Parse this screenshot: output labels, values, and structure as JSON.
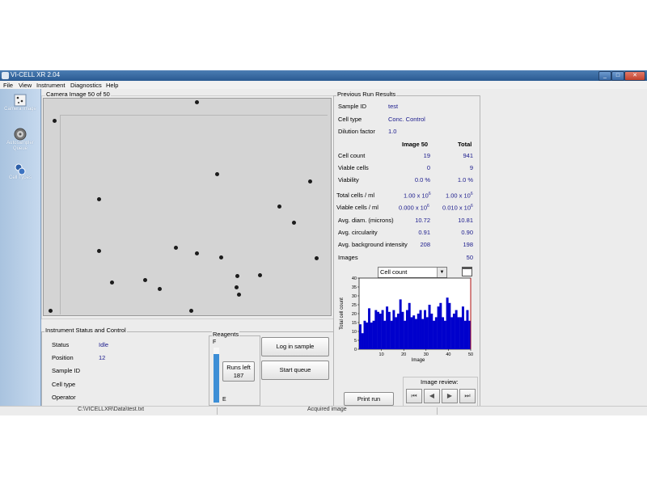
{
  "window": {
    "title": "VI-CELL XR 2.04",
    "controls": [
      "_",
      "□",
      "✕"
    ]
  },
  "menu": [
    "File",
    "View",
    "Instrument",
    "Diagnostics",
    "Help"
  ],
  "sidebar": {
    "items": [
      {
        "label": "Camera Image",
        "icon": "camera-icon"
      },
      {
        "label": "Autosampler Queue",
        "icon": "carousel-icon"
      },
      {
        "label": "Cell Types",
        "icon": "cell-types-icon"
      }
    ]
  },
  "camera": {
    "title": "Camera Image 50 of 50"
  },
  "instrument": {
    "title": "Instrument Status and Control",
    "rows": [
      {
        "label": "Status",
        "value": "Idle"
      },
      {
        "label": "Position",
        "value": "12"
      },
      {
        "label": "Sample ID",
        "value": ""
      },
      {
        "label": "Cell type",
        "value": ""
      },
      {
        "label": "Operator",
        "value": ""
      }
    ],
    "reagents_title": "Reagents",
    "reagent_full": "F",
    "reagent_empty": "E",
    "reagent_level": 0.88,
    "runs_left_label": "Runs left",
    "runs_left": "187",
    "log_button": "Log in sample",
    "start_button": "Start queue"
  },
  "results": {
    "title": "Previous Run Results",
    "sample_id_label": "Sample ID",
    "sample_id": "test",
    "cell_type_label": "Cell type",
    "cell_type": "Conc. Control",
    "dilution_label": "Dilution factor",
    "dilution": "1.0",
    "col_image": "Image 50",
    "col_total": "Total",
    "rows": [
      {
        "label": "Cell count",
        "image": "19",
        "total": "941"
      },
      {
        "label": "Viable cells",
        "image": "0",
        "total": "9"
      },
      {
        "label": "Viability",
        "image": "0.0 %",
        "total": "1.0 %"
      },
      {
        "label": "Total cells / ml",
        "image": "1.00  x 10",
        "image_exp": "6",
        "total": "1.00  x 10",
        "total_exp": "6"
      },
      {
        "label": "Viable cells / ml",
        "image": "0.000  x 10",
        "image_exp": "6",
        "total": "0.010  x 10",
        "total_exp": "6"
      },
      {
        "label": "Avg. diam. (microns)",
        "image": "10.72",
        "total": "10.81"
      },
      {
        "label": "Avg. circularity",
        "image": "0.91",
        "total": "0.90"
      },
      {
        "label": "Avg. background intensity",
        "image": "208",
        "total": "198"
      },
      {
        "label": "Images",
        "image": "",
        "total": "50"
      }
    ],
    "chart_select": "Cell count",
    "image_review_label": "Image review:",
    "print_button": "Print run"
  },
  "chart_data": {
    "type": "bar",
    "title": "",
    "xlabel": "Image",
    "ylabel": "Total cell count",
    "xlim": [
      0,
      50
    ],
    "ylim": [
      0,
      40
    ],
    "xticks": [
      "10",
      "20",
      "30",
      "40",
      "50"
    ],
    "yticks": [
      "0",
      "5",
      "10",
      "15",
      "20",
      "25",
      "30",
      "35",
      "40"
    ],
    "x": [
      1,
      2,
      3,
      4,
      5,
      6,
      7,
      8,
      9,
      10,
      11,
      12,
      13,
      14,
      15,
      16,
      17,
      18,
      19,
      20,
      21,
      22,
      23,
      24,
      25,
      26,
      27,
      28,
      29,
      30,
      31,
      32,
      33,
      34,
      35,
      36,
      37,
      38,
      39,
      40,
      41,
      42,
      43,
      44,
      45,
      46,
      47,
      48,
      49,
      50
    ],
    "values": [
      14,
      9,
      16,
      15,
      23,
      15,
      16,
      22,
      21,
      20,
      22,
      16,
      24,
      21,
      16,
      22,
      18,
      20,
      28,
      21,
      16,
      22,
      26,
      18,
      19,
      17,
      20,
      22,
      17,
      22,
      18,
      25,
      20,
      16,
      18,
      24,
      26,
      18,
      16,
      29,
      26,
      18,
      20,
      22,
      18,
      18,
      24,
      16,
      22,
      16
    ],
    "color": "#0000cc"
  },
  "statusbar": {
    "path": "C:\\VICELLXR\\Data\\test.txt",
    "message": "Acquired image"
  },
  "colors": {
    "titlebar": "#2a5a92",
    "sidebar": "#b8cfe8",
    "value_text": "#1a1a8c",
    "bar": "#0000cc",
    "reagent": "#3c8ed6"
  }
}
